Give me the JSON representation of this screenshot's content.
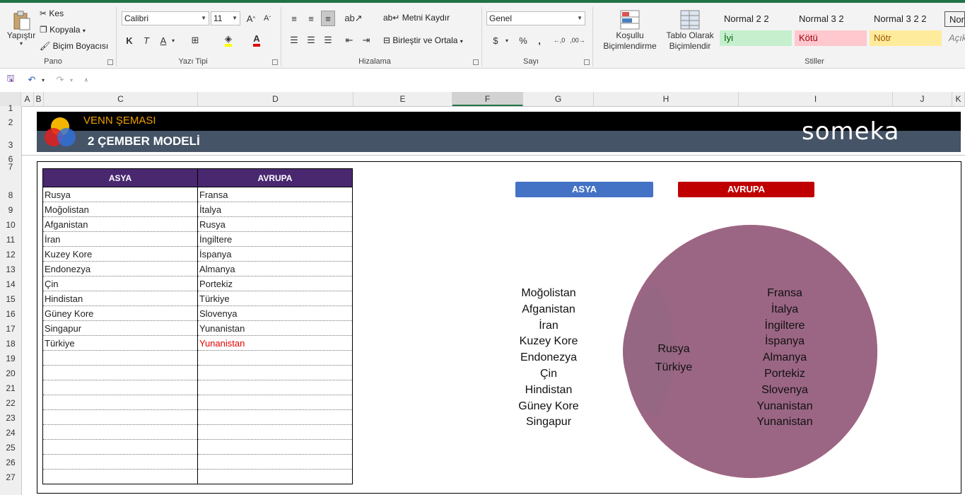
{
  "ribbon": {
    "clipboard": {
      "paste": "Yapıştır",
      "cut": "Kes",
      "copy": "Kopyala",
      "format_painter": "Biçim Boyacısı",
      "group": "Pano"
    },
    "font": {
      "name": "Calibri",
      "size": "11",
      "bold": "K",
      "italic": "T",
      "underline": "A",
      "group": "Yazı Tipi"
    },
    "alignment": {
      "wrap": "Metni Kaydır",
      "merge": "Birleştir ve Ortala",
      "group": "Hizalama"
    },
    "number": {
      "format": "Genel",
      "group": "Sayı"
    },
    "styles": {
      "conditional": "Koşullu Biçimlendirme",
      "table": "Tablo Olarak Biçimlendir",
      "cells": [
        {
          "label": "Normal 2 2",
          "bg": "#ffffff",
          "color": "#000000"
        },
        {
          "label": "Normal 3 2",
          "bg": "#ffffff",
          "color": "#000000"
        },
        {
          "label": "Normal 3 2 2",
          "bg": "#ffffff",
          "color": "#000000"
        },
        {
          "label": "Nor",
          "bg": "#ffffff",
          "color": "#000000"
        },
        {
          "label": "İyi",
          "bg": "#c6efce",
          "color": "#006100"
        },
        {
          "label": "Kötü",
          "bg": "#ffc7ce",
          "color": "#9c0006"
        },
        {
          "label": "Nötr",
          "bg": "#ffeb9c",
          "color": "#9c5700"
        },
        {
          "label": "Açık",
          "bg": "#ffffff",
          "color": "#7f7f7f"
        }
      ],
      "group": "Stiller"
    }
  },
  "columns": [
    "A",
    "B",
    "C",
    "D",
    "E",
    "F",
    "G",
    "H",
    "I",
    "J",
    "K"
  ],
  "rows": [
    "1",
    "2",
    "3",
    "6",
    "7",
    "8",
    "9",
    "10",
    "11",
    "12",
    "13",
    "14",
    "15",
    "16",
    "17",
    "18",
    "19",
    "20",
    "21",
    "22",
    "23",
    "24",
    "25",
    "26",
    "27"
  ],
  "banner": {
    "title": "VENN ŞEMASI",
    "subtitle": "2 ÇEMBER MODELİ",
    "brand": "someka"
  },
  "table": {
    "headers": [
      "ASYA",
      "AVRUPA"
    ],
    "asya": [
      "Rusya",
      "Moğolistan",
      "Afganistan",
      "İran",
      "Kuzey Kore",
      "Endonezya",
      "Çin",
      "Hindistan",
      "Güney Kore",
      "Singapur",
      "Türkiye"
    ],
    "avrupa": [
      "Fransa",
      "İtalya",
      "Rusya",
      "İngiltere",
      "İspanya",
      "Almanya",
      "Portekiz",
      "Türkiye",
      "Slovenya",
      "Yunanistan",
      "Yunanistan"
    ]
  },
  "venn": {
    "left_label": "ASYA",
    "right_label": "AVRUPA",
    "left_color": "#7f97c1",
    "right_color": "#ff6e6e",
    "overlap_color": "#9b6684",
    "left_only": [
      "Moğolistan",
      "Afganistan",
      "İran",
      "Kuzey Kore",
      "Endonezya",
      "Çin",
      "Hindistan",
      "Güney Kore",
      "Singapur"
    ],
    "both": [
      "Rusya",
      "Türkiye"
    ],
    "right_only": [
      "Fransa",
      "İtalya",
      "İngiltere",
      "İspanya",
      "Almanya",
      "Portekiz",
      "Slovenya",
      "Yunanistan",
      "Yunanistan"
    ]
  }
}
